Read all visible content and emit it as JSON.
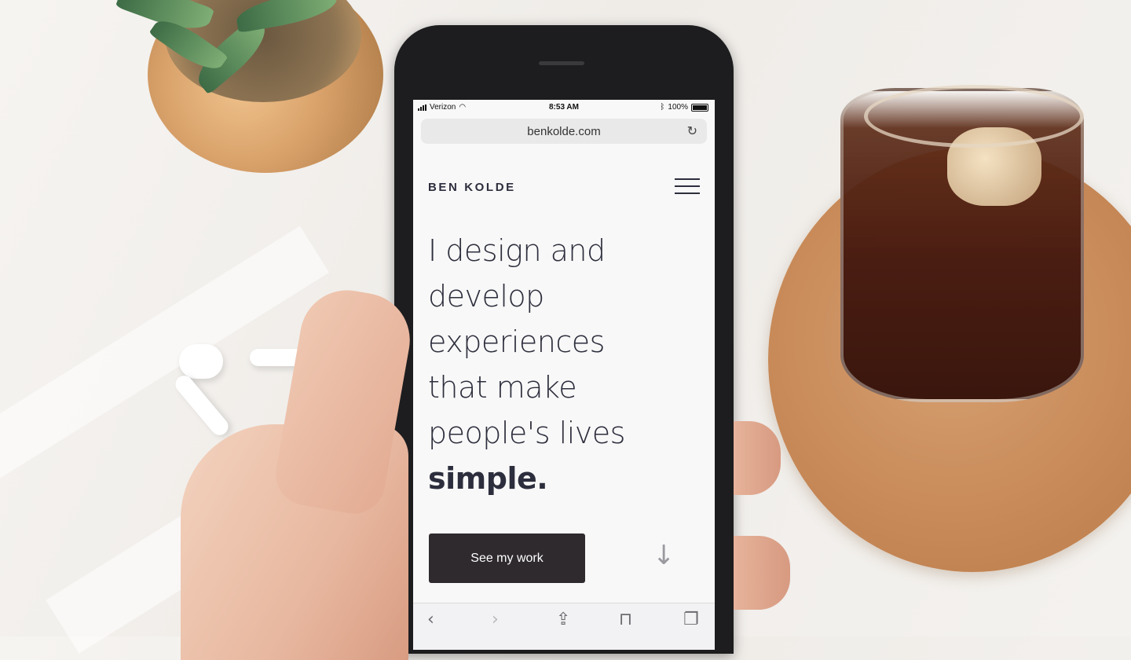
{
  "status": {
    "carrier": "Verizon",
    "time": "8:53 AM",
    "battery": "100%"
  },
  "browser": {
    "url": "benkolde.com",
    "reload_icon": "reload-icon",
    "toolbar_icons": [
      "back-icon",
      "forward-icon",
      "share-icon",
      "bookmarks-icon",
      "tabs-icon"
    ]
  },
  "site": {
    "brand": "BEN KOLDE",
    "headline_lines": [
      "I design and",
      "develop",
      "experiences",
      "that make",
      "people's lives"
    ],
    "headline_bold": "simple.",
    "cta_label": "See my work",
    "scroll_icon": "down-arrow-icon"
  },
  "colors": {
    "text_dark": "#2d2e3d",
    "button_bg": "#2f2a2e",
    "screen_bg": "#f8f8f8"
  }
}
